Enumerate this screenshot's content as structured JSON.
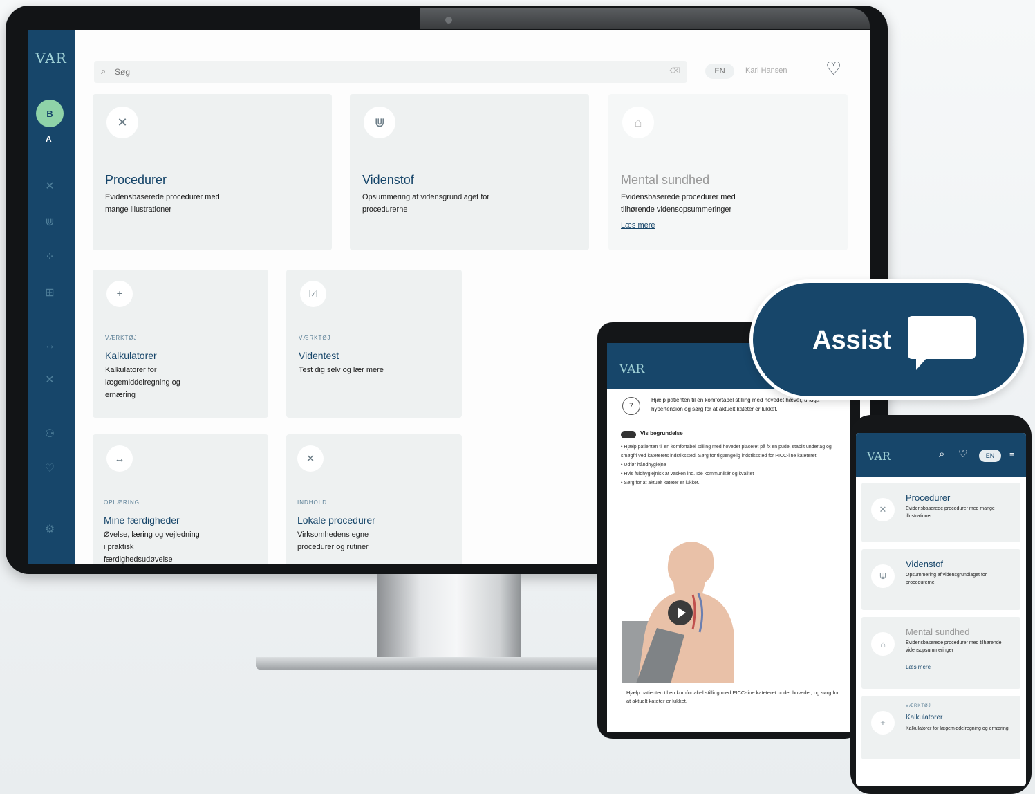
{
  "desktop": {
    "logo": "VAR",
    "sidebar": {
      "avatar_initial": "B",
      "secondary_letter": "A",
      "icons": [
        "procedures-icon",
        "knowledge-icon",
        "grid-icon",
        "calculator-icon",
        "arrows-icon",
        "network-icon",
        "people-icon",
        "heart-icon",
        "settings-icon"
      ]
    },
    "search": {
      "placeholder": "Søg",
      "clear": "⌫"
    },
    "lang": "EN",
    "user": "Kari Hansen",
    "cards_top": [
      {
        "title": "Procedurer",
        "desc": "Evidensbaserede procedurer med mange illustrationer",
        "icon": "procedures-icon"
      },
      {
        "title": "Videnstof",
        "desc": "Opsummering af vidensgrundlaget for procedurerne",
        "icon": "knowledge-icon"
      },
      {
        "title": "Mental sundhed",
        "desc": "Evidensbaserede procedurer med tilhørende vidensopsummeringer",
        "link": "Læs mere",
        "icon": "lock-icon"
      }
    ],
    "cards_row2": [
      {
        "tag": "VÆRKTØJ",
        "title": "Kalkulatorer",
        "desc": "Kalkulatorer for lægemiddelregning og ernæring",
        "icon": "calculator-icon"
      },
      {
        "tag": "VÆRKTØJ",
        "title": "Videntest",
        "desc": "Test dig selv og lær mere",
        "icon": "checkbox-icon"
      }
    ],
    "cards_row3": [
      {
        "tag": "OPLÆRING",
        "title": "Mine færdigheder",
        "desc": "Øvelse, læring og vejledning i praktisk færdighedsudøvelse",
        "icon": "arrows-icon"
      },
      {
        "tag": "INDHOLD",
        "title": "Lokale procedurer",
        "desc": "Virksomhedens egne procedurer og rutiner",
        "icon": "procedures-icon"
      }
    ]
  },
  "tablet": {
    "logo": "VAR",
    "step_number": "7",
    "step_text": "Hjælp patienten til en komfortabel stilling med hovedet hævet, undgå hypertension og sørg for at aktuelt kateter er lukket.",
    "toggle_label": "Vis begrundelse",
    "bullets": [
      "Hjælp patienten til en komfortabel stilling med hovedet placeret på fx en pude, stabilt underlag og smøgfri ved kateterets indstikssted. Sørg for tilgængelig indstikssted for PICC-line kateteret.",
      "Udfør håndhygiejne",
      "Hvis fuldhygiejnisk at vasken ind. Idé kommunikér og kvalitet",
      "Sørg for at aktuelt kateter er lukket."
    ],
    "caption": "Hjælp patienten til en komfortabel stilling med PICC-line kateteret under hovedet, og sørg for at aktuelt kateter er lukket."
  },
  "assist": {
    "label": "Assist"
  },
  "phone": {
    "logo": "VAR",
    "lang": "EN",
    "cards": [
      {
        "title": "Procedurer",
        "desc": "Evidensbaserede procedurer med mange illustrationer",
        "icon": "procedures-icon"
      },
      {
        "title": "Videnstof",
        "desc": "Opsummering af vidensgrundlaget for procedurerne",
        "icon": "knowledge-icon"
      },
      {
        "title": "Mental sundhed",
        "desc": "Evidensbaserede procedurer med tilhørende vidensopsummeringer",
        "link": "Læs mere",
        "icon": "lock-icon"
      },
      {
        "tag": "VÆRKTØJ",
        "title": "Kalkulatorer",
        "desc": "Kalkulatorer for lægemiddelregning og ernæring",
        "icon": "calculator-icon"
      }
    ]
  },
  "colors": {
    "brand": "#17466a",
    "card_bg": "#eef1f1",
    "accent_green": "#8fd3a8"
  }
}
